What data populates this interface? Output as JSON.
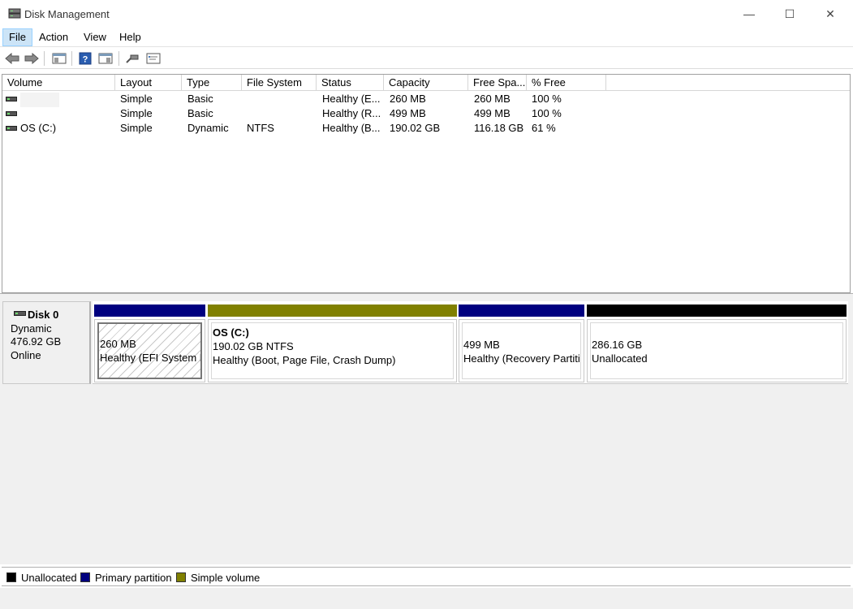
{
  "window": {
    "title": "Disk Management",
    "minimize": "—",
    "maximize": "☐",
    "close": "✕"
  },
  "menu": [
    "File",
    "Action",
    "View",
    "Help"
  ],
  "colors": {
    "unallocated": "#000000",
    "primary": "#00007f",
    "simple": "#808000"
  },
  "columns": [
    "Volume",
    "Layout",
    "Type",
    "File System",
    "Status",
    "Capacity",
    "Free Spa...",
    "% Free"
  ],
  "volumes": [
    {
      "volume": "",
      "layout": "Simple",
      "type": "Basic",
      "fs": "",
      "status": "Healthy (E...",
      "capacity": "260 MB",
      "free": "260 MB",
      "pct": "100 %"
    },
    {
      "volume": "",
      "layout": "Simple",
      "type": "Basic",
      "fs": "",
      "status": "Healthy (R...",
      "capacity": "499 MB",
      "free": "499 MB",
      "pct": "100 %"
    },
    {
      "volume": "OS (C:)",
      "layout": "Simple",
      "type": "Dynamic",
      "fs": "NTFS",
      "status": "Healthy (B...",
      "capacity": "190.02 GB",
      "free": "116.18 GB",
      "pct": "61 %"
    }
  ],
  "disk": {
    "name": "Disk 0",
    "kind": "Dynamic",
    "size": "476.92 GB",
    "state": "Online",
    "partitions": [
      {
        "title": "",
        "size": "260 MB",
        "status": "Healthy (EFI System P"
      },
      {
        "title": "OS  (C:)",
        "size": "190.02 GB NTFS",
        "status": "Healthy (Boot, Page File, Crash Dump)"
      },
      {
        "title": "",
        "size": "499 MB",
        "status": "Healthy (Recovery Partiti"
      },
      {
        "title": "",
        "size": "286.16 GB",
        "status": "Unallocated"
      }
    ]
  },
  "legend": [
    "Unallocated",
    "Primary partition",
    "Simple volume"
  ]
}
